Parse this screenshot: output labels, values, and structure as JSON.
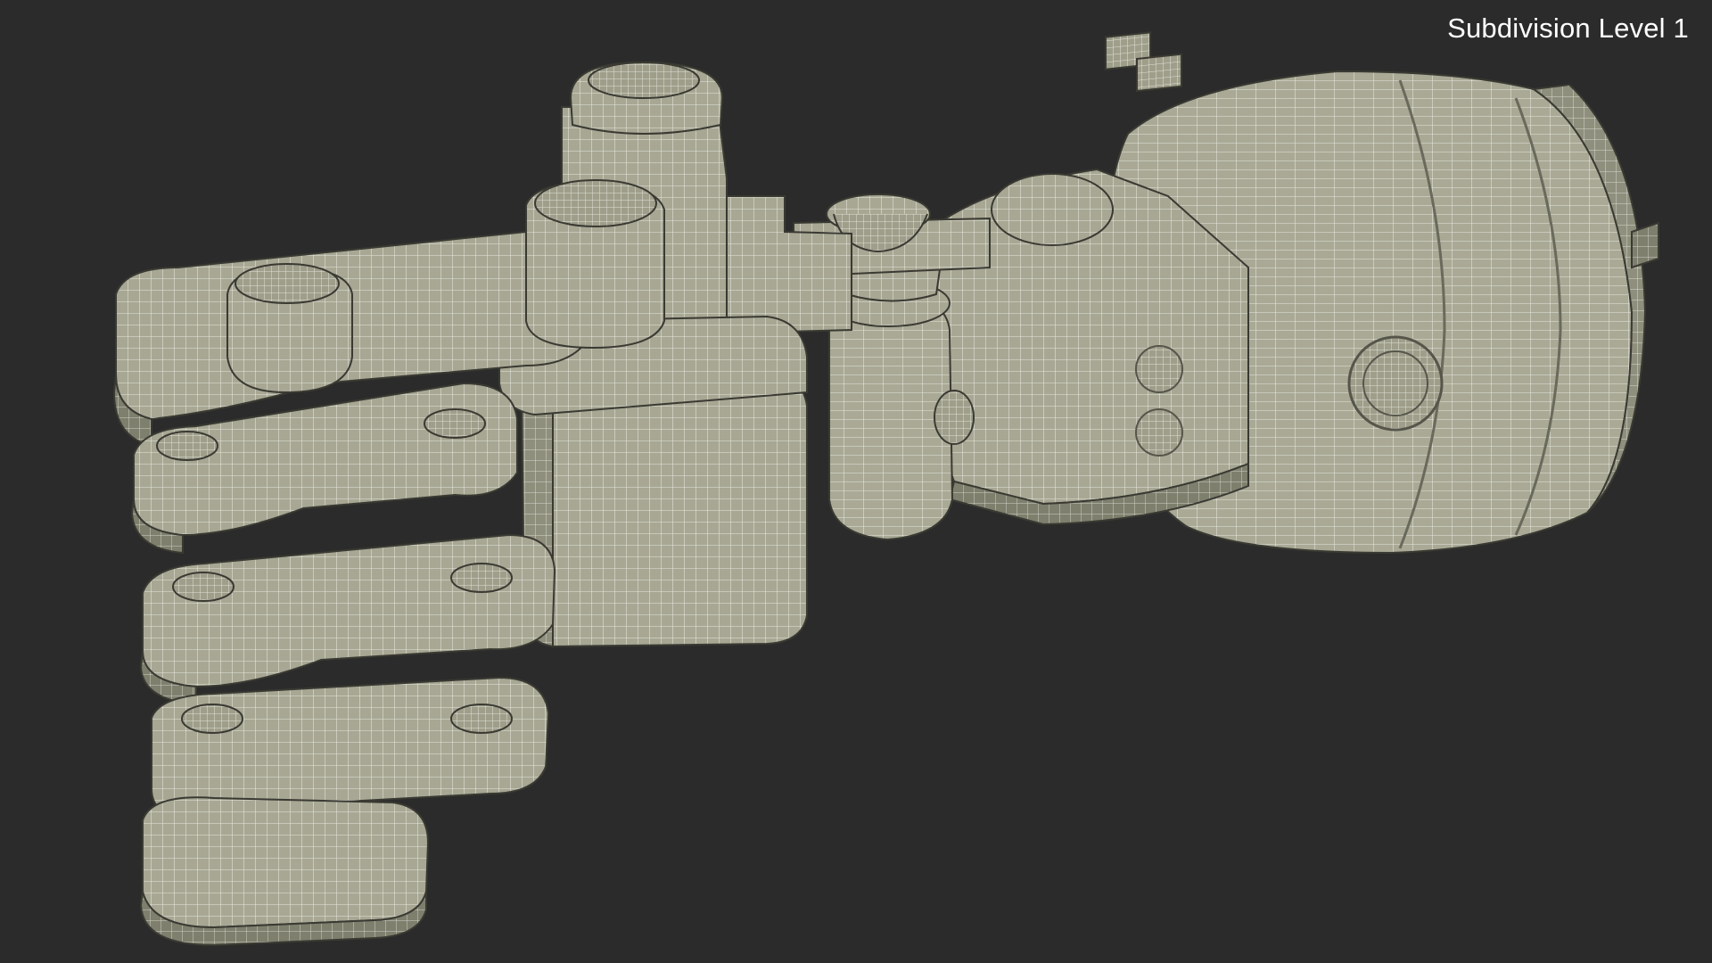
{
  "viewport": {
    "overlay_label": "Subdivision Level 1",
    "background_color": "#2b2b2b",
    "label_color": "#ffffff"
  },
  "model": {
    "subject": "robotic-hand-wireframe-render",
    "surface_color": "#a7a794",
    "wire_color": "#ffffff"
  }
}
